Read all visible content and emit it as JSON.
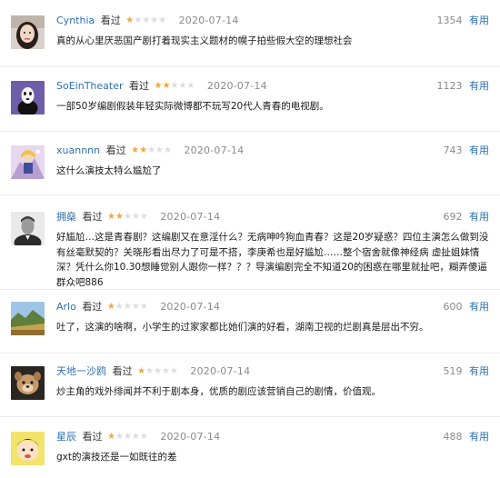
{
  "reviews": [
    {
      "user": "Cynthia",
      "action": "看过",
      "rating": 1,
      "date": "2020-07-14",
      "votes": "1354",
      "useful_label": "有用",
      "content": "真的从心里厌恶国产剧打着现实主义题材的幌子拍些假大空的理想社会"
    },
    {
      "user": "SoEinTheater",
      "action": "看过",
      "rating": 2,
      "date": "2020-07-14",
      "votes": "1123",
      "useful_label": "有用",
      "content": "一部50岁编剧假装年轻实际微博都不玩写20代人青春的电视剧。"
    },
    {
      "user": "xuannnn",
      "action": "看过",
      "rating": 2,
      "date": "2020-07-14",
      "votes": "743",
      "useful_label": "有用",
      "content": "这什么演技太特么尴尬了"
    },
    {
      "user": "拥燊",
      "action": "看过",
      "rating": 2,
      "date": "2020-07-14",
      "votes": "692",
      "useful_label": "有用",
      "content": "好尴尬…这是青春剧？这编剧又在意淫什么？无病呻吟狗血青春？这是20岁疑惑？四位主演怎么做到没有丝毫默契的？关晓彤看出尽力了可是不搭，李庚希也是好尴尬……整个宿舍就像神经病 虚扯姐妹情深？凭什么你10.30想睡觉别人跟你一样？？？导演编剧完全不知道20的困惑在哪里就扯吧，糊弄傻逼群众吧886"
    },
    {
      "user": "Arlo",
      "action": "看过",
      "rating": 1,
      "date": "2020-07-14",
      "votes": "600",
      "useful_label": "有用",
      "content": "吐了，这演的啥啊，小学生的过家家都比她们演的好看，湖南卫视的烂剧真是层出不穷。"
    },
    {
      "user": "天地一沙鸥",
      "action": "看过",
      "rating": 1,
      "date": "2020-07-14",
      "votes": "519",
      "useful_label": "有用",
      "content": "炒主角的戏外绯闻并不利于剧本身，优质的剧应该营销自己的剧情，价值观。"
    },
    {
      "user": "星辰",
      "action": "看过",
      "rating": 1,
      "date": "2020-07-14",
      "votes": "488",
      "useful_label": "有用",
      "content": "gxt的演技还是一如既往的差"
    }
  ]
}
